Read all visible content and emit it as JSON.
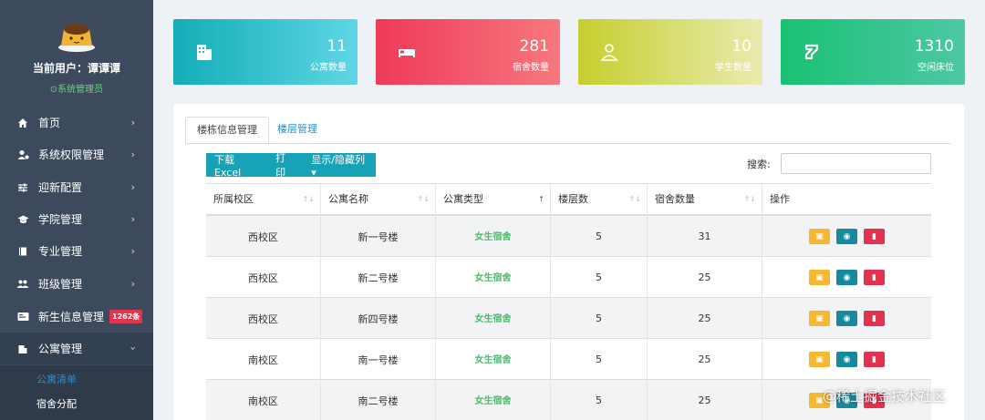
{
  "sidebar": {
    "user_line": "当前用户：谭谭谭",
    "role": "⊙系统管理员",
    "items": [
      {
        "label": "首页",
        "icon": "home-icon"
      },
      {
        "label": "系统权限管理",
        "icon": "user-cog-icon"
      },
      {
        "label": "迎新配置",
        "icon": "sliders-icon"
      },
      {
        "label": "学院管理",
        "icon": "graduation-cap-icon"
      },
      {
        "label": "专业管理",
        "icon": "book-icon"
      },
      {
        "label": "班级管理",
        "icon": "users-icon"
      },
      {
        "label": "新生信息管理",
        "icon": "id-card-icon",
        "badge": "1262条"
      },
      {
        "label": "公寓管理",
        "icon": "building-icon"
      }
    ],
    "sub_items": [
      "公寓清单",
      "宿舍分配"
    ]
  },
  "cards": [
    {
      "value": "11",
      "label": "公寓数量",
      "icon": "building-icon",
      "color": "#1fb5bd"
    },
    {
      "value": "281",
      "label": "宿舍数量",
      "icon": "bed-icon",
      "color": "#f0475f"
    },
    {
      "value": "10",
      "label": "学生数量",
      "icon": "user-icon",
      "color": "#cbd33a"
    },
    {
      "value": "1310",
      "label": "空闲床位",
      "icon": "vacancy-icon",
      "color": "#22c07e"
    }
  ],
  "tabs": [
    "楼栋信息管理",
    "楼层管理"
  ],
  "toolbar": {
    "excel": "下载Excel",
    "print": "打印",
    "columns": "显示/隐藏列▾"
  },
  "search": {
    "label": "搜索:",
    "placeholder": ""
  },
  "table": {
    "headers": [
      "所属校区",
      "公寓名称",
      "公寓类型",
      "楼层数",
      "宿舍数量",
      "操作"
    ],
    "rows": [
      {
        "campus": "西校区",
        "name": "新一号楼",
        "type": "女生宿舍",
        "floors": "5",
        "rooms": "31"
      },
      {
        "campus": "西校区",
        "name": "新二号楼",
        "type": "女生宿舍",
        "floors": "5",
        "rooms": "25"
      },
      {
        "campus": "西校区",
        "name": "新四号楼",
        "type": "女生宿舍",
        "floors": "5",
        "rooms": "25"
      },
      {
        "campus": "南校区",
        "name": "南一号楼",
        "type": "女生宿舍",
        "floors": "5",
        "rooms": "25"
      },
      {
        "campus": "南校区",
        "name": "南二号楼",
        "type": "女生宿舍",
        "floors": "5",
        "rooms": "25"
      }
    ]
  },
  "watermark": "@稀土掘金技术社区"
}
